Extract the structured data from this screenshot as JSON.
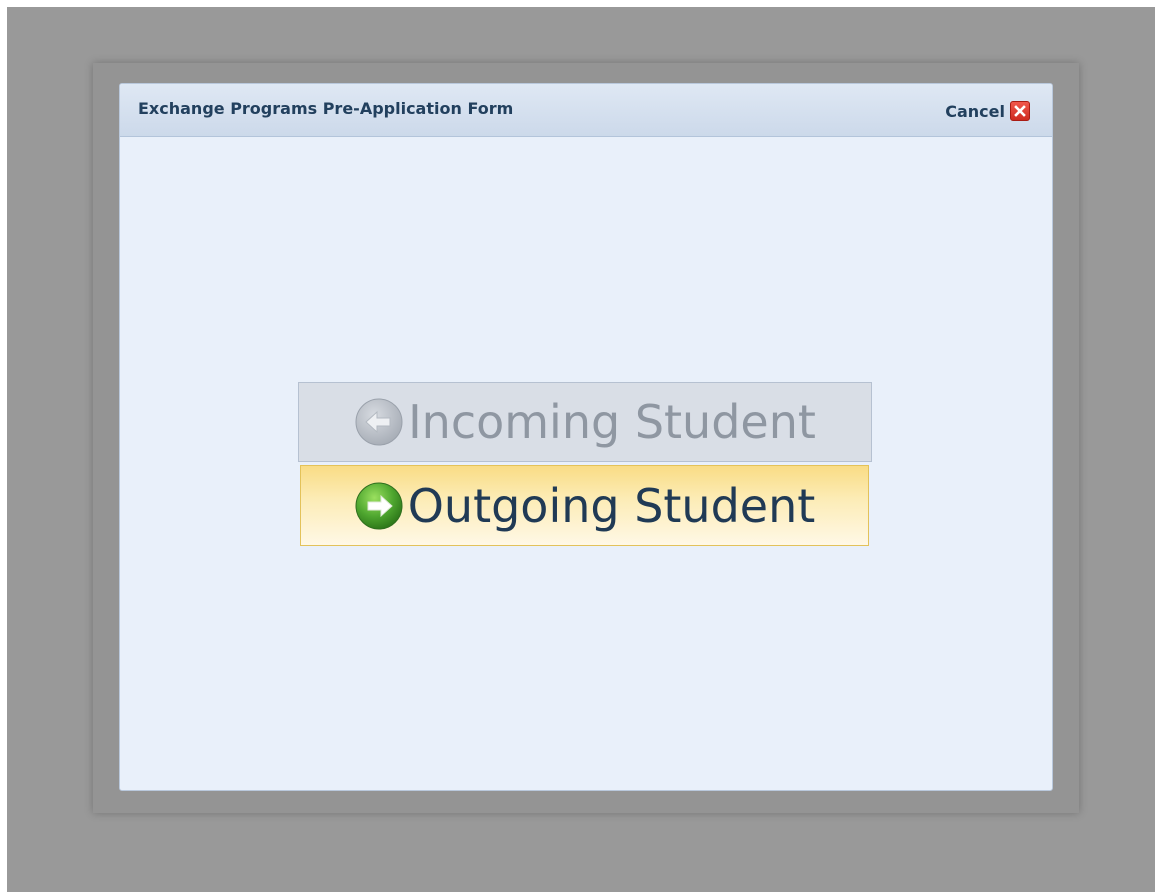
{
  "dialog": {
    "title": "Exchange Programs Pre-Application Form",
    "cancel_label": "Cancel",
    "cancel_icon": "close-icon"
  },
  "options": {
    "incoming": {
      "label": "Incoming Student",
      "icon": "arrow-left-circle-icon",
      "state": "disabled"
    },
    "outgoing": {
      "label": "Outgoing Student",
      "icon": "arrow-right-circle-icon",
      "state": "highlighted"
    }
  },
  "colors": {
    "overlay": "#999999",
    "dialog_background": "#e9f0fa",
    "title_text": "#22405e",
    "incoming_text": "#8f97a2",
    "outgoing_text": "#203a55",
    "outgoing_highlight": "#f9dc85",
    "close_red": "#d9342a",
    "go_green": "#4ea62f"
  }
}
